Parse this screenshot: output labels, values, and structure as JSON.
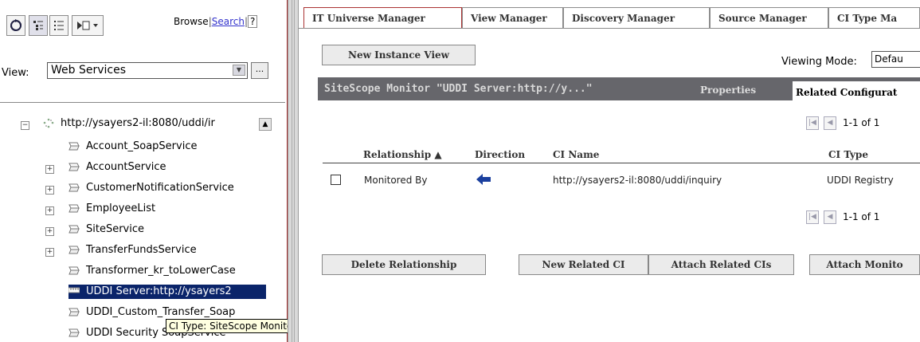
{
  "left_panel": {
    "toolbar_icons": [
      "refresh-icon",
      "tree-view-icon",
      "list-view-icon",
      "new-item-dropdown-icon"
    ],
    "browse_label": "Browse",
    "search_label": "Search",
    "help_label": "?",
    "view_label": "View:",
    "view_value": "Web Services",
    "more_label": "...",
    "tree": {
      "root": "http://ysayers2-il:8080/uddi/ir",
      "items": [
        {
          "label": "Account_SoapService",
          "expandable": false
        },
        {
          "label": "AccountService",
          "expandable": true
        },
        {
          "label": "CustomerNotificationService",
          "expandable": true
        },
        {
          "label": "EmployeeList",
          "expandable": true
        },
        {
          "label": "SiteService",
          "expandable": true
        },
        {
          "label": "TransferFundsService",
          "expandable": true
        },
        {
          "label": "Transformer_kr_toLowerCase",
          "expandable": false
        },
        {
          "label": "UDDI Server:http://ysayers2",
          "expandable": false,
          "selected": true
        },
        {
          "label": "UDDI_Custom_Transfer_Soap",
          "expandable": false
        },
        {
          "label": "UDDI Security SoapService",
          "expandable": false
        }
      ]
    },
    "tooltip": "CI Type: SiteScope Monitor"
  },
  "tabs": [
    {
      "label": "IT Universe Manager",
      "active": true
    },
    {
      "label": "View Manager",
      "active": false
    },
    {
      "label": "Discovery Manager",
      "active": false
    },
    {
      "label": "Source Manager",
      "active": false
    },
    {
      "label": "CI Type Ma",
      "active": false
    }
  ],
  "toolbar": {
    "new_instance_view": "New Instance View",
    "viewing_mode_label": "Viewing Mode:",
    "viewing_mode_value": "Defau"
  },
  "panel": {
    "title": "SiteScope Monitor \"UDDI Server:http://y...\"",
    "properties_tab": "Properties",
    "related_tab": "Related Configurat"
  },
  "pager": {
    "text": "1-1 of 1"
  },
  "table": {
    "headers": {
      "relationship": "Relationship ▲",
      "direction": "Direction",
      "ci_name": "CI Name",
      "ci_type": "CI Type"
    },
    "rows": [
      {
        "relationship": "Monitored By",
        "direction": "incoming-arrow-icon",
        "ci_name": "http://ysayers2-il:8080/uddi/inquiry",
        "ci_type": "UDDI Registry"
      }
    ]
  },
  "actions": {
    "delete_relationship": "Delete Relationship",
    "new_related_ci": "New Related CI",
    "attach_related_cis": "Attach Related CIs",
    "attach_monitor": "Attach Monito"
  },
  "colors": {
    "selection": "#0a246a",
    "panel_header": "#66666b",
    "accent_border": "#aa3333"
  }
}
